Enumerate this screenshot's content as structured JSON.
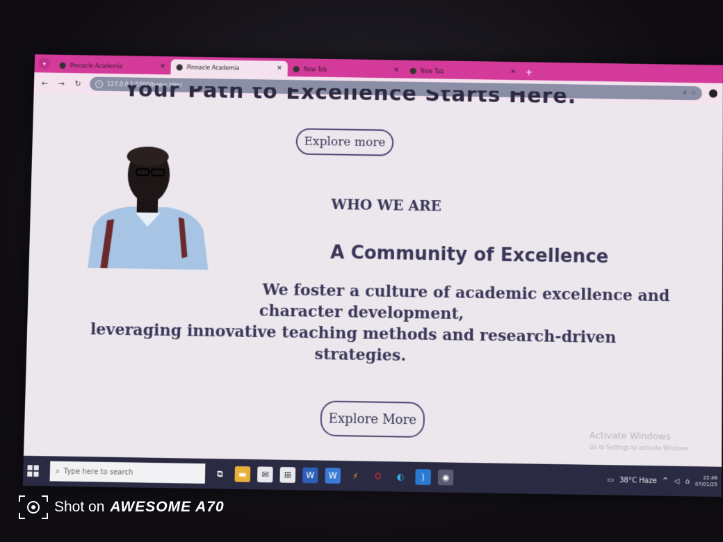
{
  "browser": {
    "tabs": [
      {
        "title": "Pinnacle Academia",
        "active": false
      },
      {
        "title": "Pinnacle Academia",
        "active": true
      },
      {
        "title": "New Tab",
        "active": false
      },
      {
        "title": "New Tab",
        "active": false
      }
    ],
    "url": "127.0.0.1:5500/home.html",
    "new_tab_symbol": "+"
  },
  "page": {
    "hero_heading_partial": "Your Path to Excellence Starts Here.",
    "explore_top_label": "Explore more",
    "who_we_are": "WHO WE ARE",
    "community_title": "A Community of Excellence",
    "description": {
      "line1": "We foster a culture of academic excellence and",
      "line2": "character development,",
      "line3": "leveraging innovative teaching methods and research-driven",
      "line4": "strategies."
    },
    "explore_bottom_label": "Explore More"
  },
  "windows_activation": {
    "title": "Activate Windows",
    "subtitle": "Go to Settings to activate Windows."
  },
  "taskbar": {
    "search_placeholder": "Type here to search",
    "weather": "38°C  Haze",
    "time": "22:46",
    "date": "07/01/25"
  },
  "watermark": {
    "prefix": "Shot on ",
    "brand": "AWESOME A70"
  },
  "colors": {
    "tab_strip": "#d33a9a",
    "page_text": "#3a3658",
    "taskbar": "#2a2a42"
  }
}
